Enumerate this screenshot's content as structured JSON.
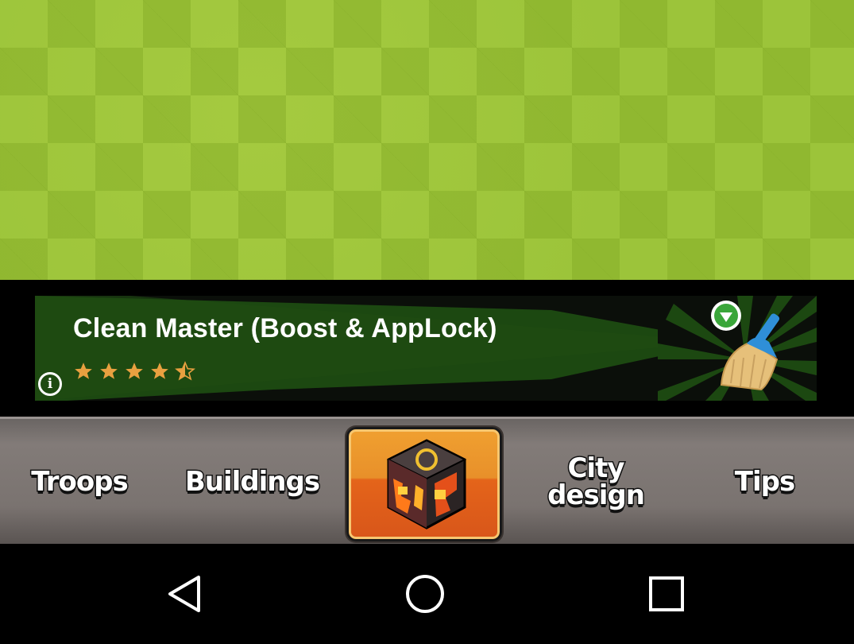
{
  "ad": {
    "title": "Clean Master (Boost & AppLock)",
    "rating": 4.5,
    "rating_max": 5,
    "info_symbol": "i"
  },
  "tabs": {
    "troops": "Troops",
    "buildings": "Buildings",
    "city_design": "City design",
    "tips": "Tips",
    "home_icon": "town-hall-icon"
  },
  "nav": {
    "back_icon": "back-triangle-icon",
    "home_icon": "home-circle-icon",
    "recents_icon": "recents-square-icon"
  },
  "colors": {
    "grass": "#9cc43a",
    "ad_green": "#1e4a12",
    "tab_active": "#e8902a",
    "star": "#e8a040"
  }
}
